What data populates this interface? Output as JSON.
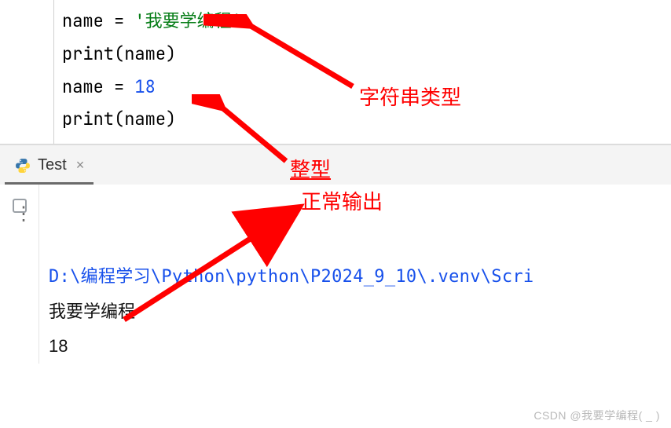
{
  "editor": {
    "lines": [
      {
        "var": "name",
        "eq": " = ",
        "str_quote": "'",
        "str_val": "我要学编程"
      },
      {
        "func": "print",
        "open": "(",
        "arg": "name",
        "close": ")"
      },
      {
        "var": "name",
        "eq": " = ",
        "num": "18"
      },
      {
        "func": "print",
        "open": "(",
        "arg": "name",
        "close": ")"
      }
    ]
  },
  "annotations": {
    "string_type": "字符串类型",
    "int_type": "整型",
    "normal_output": "正常输出"
  },
  "tabs": {
    "active": {
      "name": "Test",
      "icon": "python"
    },
    "close_glyph": "×"
  },
  "console": {
    "path": "D:\\编程学习\\Python\\python\\P2024_9_10\\.venv\\Scri",
    "output": [
      "我要学编程",
      "18"
    ]
  },
  "watermark": "CSDN @我要学编程( _ )"
}
